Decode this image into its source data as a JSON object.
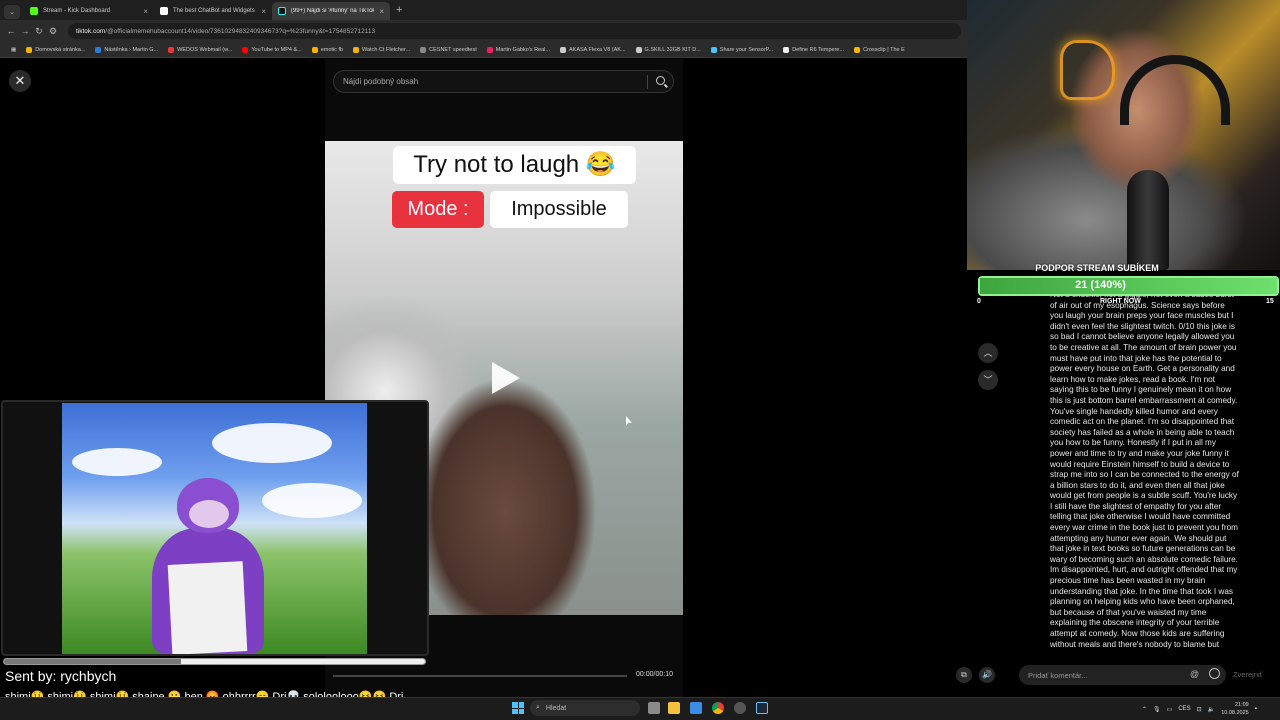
{
  "browser": {
    "tabs": [
      {
        "title": "Stream - Kick Dashboard",
        "color": "#53fc18",
        "active": false
      },
      {
        "title": "The best ChatBot and Widgets",
        "color": "#ffffff",
        "active": false
      },
      {
        "title": "(99+) Nájdi si '#funny' na TikTok",
        "color": "#ffffff",
        "active": true
      }
    ],
    "url_domain": "tiktok.com",
    "url_path": "/@officialmemehubaccount14/video/7361029483240934673?q=%23funny&t=1754852712113",
    "bookmarks": [
      {
        "label": "Domovská stránka...",
        "color": "#f4b400"
      },
      {
        "label": "Nástěnka › Martin G...",
        "color": "#2b7cd3"
      },
      {
        "label": "WEDOS Webmail (w...",
        "color": "#e53935"
      },
      {
        "label": "YouTube to MP4 &...",
        "color": "#ff0000"
      },
      {
        "label": "emotic fb",
        "color": "#f4b400"
      },
      {
        "label": "Watch Ct Fletcher...",
        "color": "#f4b400"
      },
      {
        "label": "CESNET speedtest",
        "color": "#888888"
      },
      {
        "label": "Martin Gabko's Real...",
        "color": "#e91e63"
      },
      {
        "label": "AKASA Flexa V8 (AK...",
        "color": "#cccccc"
      },
      {
        "label": "G.SKILL 32GB KIT D...",
        "color": "#cccccc"
      },
      {
        "label": "Share your SensorP...",
        "color": "#4fc3f7"
      },
      {
        "label": "Define R6 Tempere...",
        "color": "#eeeeee"
      },
      {
        "label": "Crossclip | The E",
        "color": "#f4b400"
      }
    ]
  },
  "tiktok": {
    "search_placeholder": "Nájdi podobný obsah",
    "caption_line1": "Try not to laugh 😂",
    "mode_label": "Mode :",
    "mode_value": "Impossible",
    "time": "00:00/00:10",
    "comment_placeholder": "Pridať komentár...",
    "publish_label": "Zverejniť"
  },
  "overlay": {
    "sent_by": "Sent by: rychbych",
    "progress": 0.42,
    "chat_ticker": "shimi🤑 shimi🤑 shimi🤑 shaine 😮 ben 😡 ohhrrrr😑 Dri💀 sololoolooo😝😝 Dri..."
  },
  "goal": {
    "title": "PODPOR STREAM SUBÍKEM",
    "label": "21 (140%)",
    "min": "0",
    "max": "15",
    "fill": 1.0,
    "right_now": "RIGHT NOW"
  },
  "comment_text": "Not a chuckle, not a giggle, not even a subtle burst of air out of my esophagus. Science says before you laugh your brain preps your face muscles but I didn't even feel the slightest twitch. 0/10 this joke is so bad I cannot believe anyone legally allowed you to be creative at all. The amount of brain power you must have put into that joke has the potential to power every house on Earth. Get a personality and learn how to make jokes, read a book. I'm not saying this to be funny I genuinely mean it on how this is just bottom barrel embarrassment at comedy. You've single handedly killed humor and every comedic act on the planet. I'm so disappointed that society has failed as a whole in being able to teach you how to be funny. Honestly if I put in all my power and time to try and make your joke funny it would require Einstein himself to build a device to strap me into so I can be connected to the energy of a billion stars to do it, and even then all that joke would get from people is a subtle scuff. You're lucky I still have the slightest of empathy for you after telling that joke otherwise I would have committed every war crime in the book just to prevent you from attempting any humor ever again. We should put that joke in text books so future generations can be wary of becoming such an absolute comedic failure. Im disappointed, hurt, and outright offended that my precious time has been wasted in my brain understanding that joke. In the time that took I was planning on helping kids who have been orphaned, but because of that you've waisted my time explaining the obscene integrity of your terrible attempt at comedy. Now those kids are suffering without meals and there's nobody to blame but",
  "taskbar": {
    "search_placeholder": "Hledat",
    "language": "CES",
    "time": "21:09",
    "date": "10.08.2025"
  }
}
